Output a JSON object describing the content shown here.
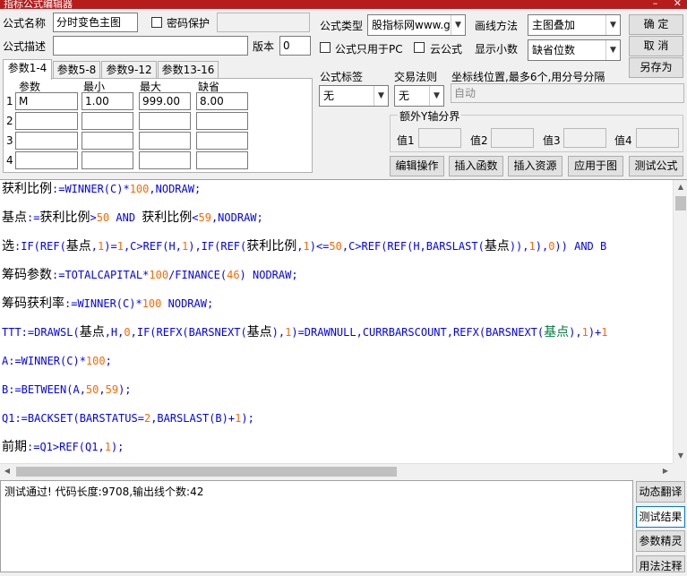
{
  "window": {
    "title": "指标公式编辑器",
    "minimize": "–",
    "close": "✕"
  },
  "form": {
    "name_label": "公式名称",
    "name_value": "分时变色主图",
    "password_label": "密码保护",
    "desc_label": "公式描述",
    "desc_value": "",
    "version_label": "版本",
    "version_value": "0",
    "type_label": "公式类型",
    "type_value": "股指标网www.g",
    "draw_label": "画线方法",
    "draw_value": "主图叠加",
    "pc_only_label": "公式只用于PC",
    "cloud_label": "云公式",
    "decimals_label": "显示小数",
    "decimals_value": "缺省位数",
    "ok_button": "确  定",
    "cancel_button": "取  消",
    "saveas_button": "另存为"
  },
  "tabs": [
    "参数1-4",
    "参数5-8",
    "参数9-12",
    "参数13-16"
  ],
  "params": {
    "headers": [
      "参数",
      "最小",
      "最大",
      "缺省"
    ],
    "rows": [
      {
        "num": "1",
        "name": "M",
        "min": "1.00",
        "max": "999.00",
        "default": "8.00"
      },
      {
        "num": "2",
        "name": "",
        "min": "",
        "max": "",
        "default": ""
      },
      {
        "num": "3",
        "name": "",
        "min": "",
        "max": "",
        "default": ""
      },
      {
        "num": "4",
        "name": "",
        "min": "",
        "max": "",
        "default": ""
      }
    ]
  },
  "labels": {
    "formula_tag_label": "公式标签",
    "formula_tag_value": "无",
    "trade_rule_label": "交易法则",
    "trade_rule_value": "无",
    "coord_label": "坐标线位置,最多6个,用分号分隔",
    "coord_value": "自动",
    "extra_y_label": "额外Y轴分界",
    "val1": "值1",
    "val2": "值2",
    "val3": "值3",
    "val4": "值4"
  },
  "toolbar": {
    "edit": "编辑操作",
    "insert_func": "插入函数",
    "insert_res": "插入资源",
    "apply_chart": "应用于图",
    "test": "测试公式"
  },
  "code_lines": [
    "获利比例:=WINNER(C)*100,NODRAW;",
    "基点:=获利比例>50 AND 获利比例<59,NODRAW;",
    "选:IF(REF(基点,1)=1,C>REF(H,1),IF(REF(获利比例,1)<=50,C>REF(REF(H,BARSLAST(基点)),1),0)) AND B",
    "筹码参数:=TOTALCAPITAL*100/FINANCE(46) NODRAW;",
    "筹码获利率:=WINNER(C)*100 NODRAW;",
    "TTT:=DRAWSL(基点,H,0,IF(REFX(BARSNEXT(基点),1)=DRAWNULL,CURRBARSCOUNT,REFX(BARSNEXT(基点),1)+1",
    "A:=WINNER(C)*100;",
    "B:=BETWEEN(A,50,59);",
    "Q1:=BACKSET(BARSTATUS=2,BARSLAST(B)+1);",
    "前期:=Q1>REF(Q1,1);"
  ],
  "output_text": "测试通过! 代码长度:9708,输出线个数:42",
  "side_buttons": [
    "动态翻译",
    "测试结果",
    "参数精灵",
    "用法注释"
  ],
  "colors": {
    "keyword": "#0000ff",
    "number": "#ff6600",
    "green_keyword": "#007a3d",
    "titlebar": "#b71c1c"
  }
}
